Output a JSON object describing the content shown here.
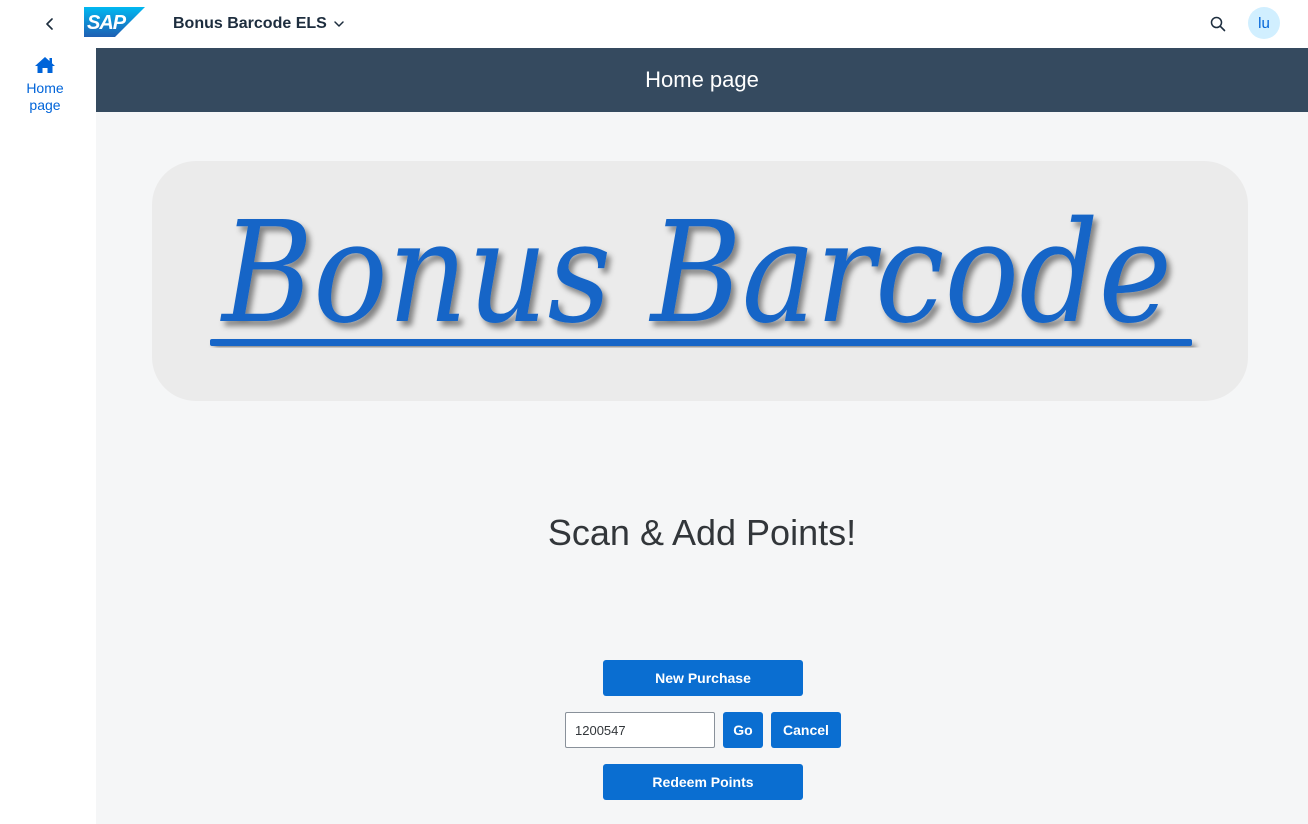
{
  "shellbar": {
    "logo_text": "SAP",
    "app_title": "Bonus Barcode ELS",
    "user_initials": "lu",
    "icons": [
      "back-icon",
      "chevron-down-icon",
      "search-icon"
    ],
    "logo_colors": {
      "gradient_top": "#00b8f1",
      "gradient_bottom": "#1e5fb3"
    }
  },
  "sidenav": {
    "items": [
      {
        "label": "Home page",
        "icon": "home-icon"
      }
    ]
  },
  "header": {
    "title": "Home page"
  },
  "banner": {
    "text": "Bonus Barcode",
    "text_color": "#1565c7"
  },
  "main": {
    "subtitle": "Scan & Add Points!",
    "new_purchase_label": "New Purchase",
    "barcode_value": "1200547",
    "go_label": "Go",
    "cancel_label": "Cancel",
    "redeem_label": "Redeem Points"
  },
  "colors": {
    "header_bg": "#354a5f",
    "button_bg": "#0a6ed1",
    "content_bg": "#f5f6f7",
    "banner_bg": "#ebebeb",
    "avatar_bg": "#d1efff"
  }
}
